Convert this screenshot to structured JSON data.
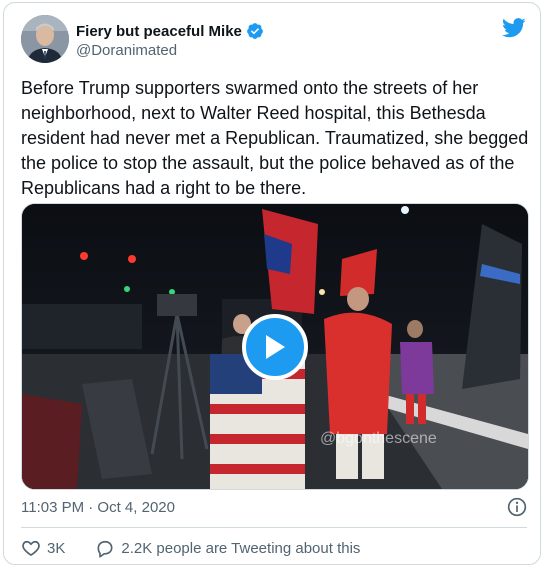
{
  "tweet": {
    "author_name": "Fiery but peaceful Mike",
    "author_handle": "@Doranimated",
    "text": "Before Trump supporters swarmed onto the streets of her neighborhood, next to Walter Reed hospital, this Bethesda resident had never met a Republican. Traumatized, she begged the police to stop the assault, but the police behaved as of the Republicans had a right to be there.",
    "timestamp": "11:03 PM · Oct 4, 2020",
    "likes_count": "3K",
    "discussion_text": "2.2K people are Tweeting about this"
  },
  "media": {
    "watermark": "@bgonthescene"
  },
  "colors": {
    "twitter_blue": "#1d9bf0",
    "like_red": "#e0245e",
    "secondary_text": "#536471",
    "border": "#cfd9de"
  },
  "icons": {
    "brand": "twitter-bird-icon",
    "verified": "verified-badge-icon",
    "play": "play-icon",
    "info": "info-icon",
    "like": "heart-icon",
    "reply": "speech-bubble-icon"
  }
}
